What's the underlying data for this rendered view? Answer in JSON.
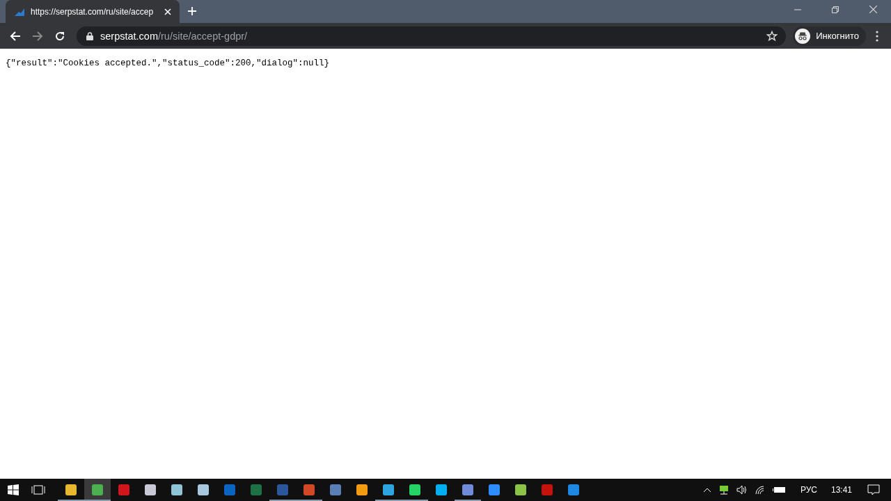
{
  "tab": {
    "title": "https://serpstat.com/ru/site/accep",
    "selected": true
  },
  "address": {
    "host": "serpstat.com",
    "path": "/ru/site/accept-gdpr/"
  },
  "profile": {
    "label": "Инкогнито"
  },
  "content": {
    "text": "{\"result\":\"Cookies accepted.\",\"status_code\":200,\"dialog\":null}"
  },
  "taskbar": {
    "apps": [
      {
        "color": "#e8b730",
        "running": true,
        "selected": false
      },
      {
        "color": "#4caf50",
        "running": true,
        "selected": true
      },
      {
        "color": "#d0161d",
        "running": false,
        "selected": false
      },
      {
        "color": "#c9c9d6",
        "running": false,
        "selected": false
      },
      {
        "color": "#8fc3d6",
        "running": false,
        "selected": false
      },
      {
        "color": "#a8c8e0",
        "running": false,
        "selected": false
      },
      {
        "color": "#0a64c0",
        "running": false,
        "selected": false
      },
      {
        "color": "#1e7145",
        "running": false,
        "selected": false
      },
      {
        "color": "#2b579a",
        "running": true,
        "selected": false
      },
      {
        "color": "#d24726",
        "running": true,
        "selected": false
      },
      {
        "color": "#5b7fb5",
        "running": false,
        "selected": false
      },
      {
        "color": "#f39c12",
        "running": false,
        "selected": false
      },
      {
        "color": "#2ca5e0",
        "running": true,
        "selected": false
      },
      {
        "color": "#25d366",
        "running": true,
        "selected": false
      },
      {
        "color": "#00aff0",
        "running": false,
        "selected": false
      },
      {
        "color": "#7289da",
        "running": true,
        "selected": false
      },
      {
        "color": "#2d8cff",
        "running": false,
        "selected": false
      },
      {
        "color": "#8bc34a",
        "running": false,
        "selected": false
      },
      {
        "color": "#c4120d",
        "running": false,
        "selected": false
      },
      {
        "color": "#1e88e5",
        "running": false,
        "selected": false
      }
    ],
    "language": "РУС",
    "time": "13:41"
  }
}
